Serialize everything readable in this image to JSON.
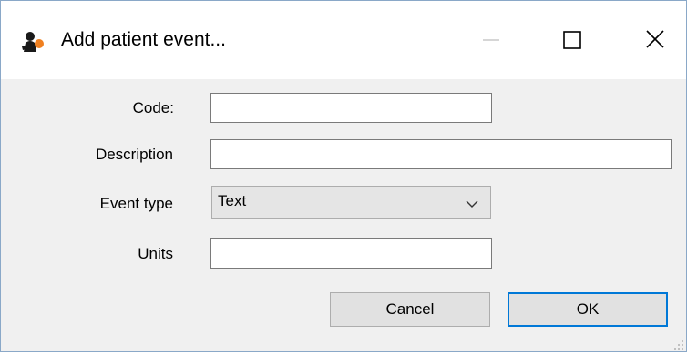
{
  "window": {
    "title": "Add patient event...",
    "app_icon": "mSupply-app-icon",
    "controls": {
      "minimize_icon": "minimize-icon",
      "maximize_icon": "maximize-icon",
      "close_icon": "close-icon"
    }
  },
  "form": {
    "code": {
      "label": "Code:",
      "value": ""
    },
    "description": {
      "label": "Description",
      "value": ""
    },
    "event_type": {
      "label": "Event type",
      "selected": "Text",
      "icon": "chevron-down-icon"
    },
    "units": {
      "label": "Units",
      "value": ""
    }
  },
  "buttons": {
    "cancel_label": "Cancel",
    "ok_label": "OK"
  },
  "colors": {
    "ok_border": "#0078d7",
    "dialog_bg": "#f0f0f0",
    "titlebar_bg": "#ffffff",
    "app_icon_accent": "#f08020"
  }
}
